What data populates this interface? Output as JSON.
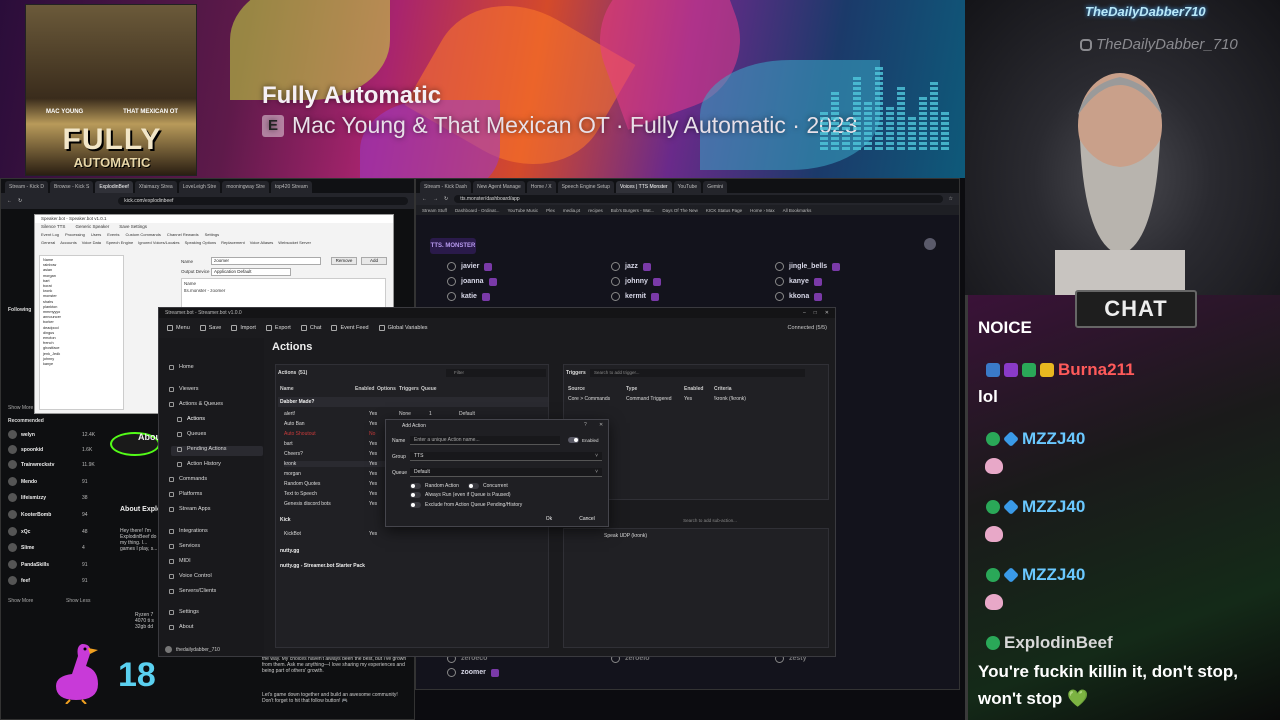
{
  "banner": {
    "album_title": "FULLY",
    "album_subtitle": "AUTOMATIC",
    "album_names": [
      "MAC YOUNG",
      "THAT MEXICAN OT"
    ],
    "song_title": "Fully Automatic",
    "explicit_badge": "E",
    "song_artist": "Mac Young & That Mexican OT · Fully Automatic · 2023"
  },
  "webcam": {
    "tag": "TheDailyDabber710",
    "handle": "TheDailyDabber_710"
  },
  "chat": {
    "header": "CHAT",
    "messages": [
      {
        "text": "NOICE"
      },
      {
        "user": "Burna211",
        "color": "#ff5a5a",
        "text": "lol"
      },
      {
        "user": "MZZJ40",
        "color": "#6ac8ff"
      },
      {
        "user": "MZZJ40",
        "color": "#6ac8ff"
      },
      {
        "user": "MZZJ40",
        "color": "#6ac8ff"
      },
      {
        "user": "ExplodinBeef",
        "color": "#d8d8d8",
        "text_line1": "You're fuckin killin it, don't stop,",
        "text_line2": "won't stop 💚"
      }
    ]
  },
  "left_browser": {
    "tabs": [
      "Stream - Kick D",
      "Browse - Kick S",
      "ExplodinBeef",
      "Xfaimazy Strea",
      "LoveLeigh Stre",
      "mooningway Stre",
      "top420 Stream"
    ],
    "url": "kick.com/explodinbeef",
    "sidebar": {
      "following": "Following",
      "show_more": "Show More",
      "recommended": "Recommended",
      "show_more2": "Show More",
      "show_less": "Show Less",
      "rows": [
        {
          "name": "welyn",
          "count": "12.4K"
        },
        {
          "name": "spoonkid",
          "count": "1.6K"
        },
        {
          "name": "Trainwreckstv",
          "count": "11.9K"
        },
        {
          "name": "Mendo",
          "count": "91"
        },
        {
          "name": "lifeismizzy",
          "count": "38"
        },
        {
          "name": "KooterBomb",
          "count": "94"
        },
        {
          "name": "xQc",
          "count": "48"
        },
        {
          "name": "Slime",
          "count": "4"
        },
        {
          "name": "PandaSkills",
          "count": "91"
        },
        {
          "name": "feef",
          "count": "91"
        }
      ]
    },
    "about_title": "About Explo",
    "about_text": "Hey there! I'm ExplodinBeef do my thing. I... games I play, s...",
    "bio_text": "the way. My choices haven't always been the best, but I've grown from them. Ask me anything—I love sharing my experiences and being part of others' growth.",
    "bio_text2": "Let's game down together and build an awesome community! Don't forget to hit that follow button! 🎮",
    "pc_specs": "Ryzen 7 4070 ti s 32gb dd",
    "follower_count": "18"
  },
  "tts_browser": {
    "tabs": [
      "Stream - Kick Dash",
      "New Agent Manage",
      "Home / X",
      "Speech Engine Setup",
      "Voices | TTS Monster",
      "YouTube",
      "Gemini"
    ],
    "url": "tts.monster/dashboard/app",
    "bookmarks": [
      "Stream Stuff",
      "Dashboard - Ordinat...",
      "YouTube Music",
      "Plex",
      "media.pt",
      "recipes",
      "Bob's Burgers - Wat...",
      "Days Of The New",
      "KICK Status Page",
      "Home › Max",
      "All Bookmarks"
    ],
    "logo": "TTS. MONSTER",
    "voices": [
      {
        "name": "javier"
      },
      {
        "name": "jazz"
      },
      {
        "name": "jingle_bells"
      },
      {
        "name": "joanna"
      },
      {
        "name": "johnny"
      },
      {
        "name": "kanye"
      },
      {
        "name": "katie"
      },
      {
        "name": "kermit"
      },
      {
        "name": "kkona"
      }
    ],
    "bottom_voices": [
      "zeroeco",
      "zeroelo",
      "zesty",
      "zoomer"
    ]
  },
  "speaker": {
    "title": "Speaker.bot - Speaker.bot v1.0.1",
    "menu": [
      "Silence TTS",
      "Generic Speaker",
      "Save Settings"
    ],
    "tabs": [
      "Event Log",
      "Processing",
      "Users",
      "Events",
      "Custom Commands",
      "Channel Rewards",
      "Settings"
    ],
    "subtabs": [
      "General",
      "Accounts",
      "Voice Data",
      "Speech Engine",
      "Ignored Voices/Locales",
      "Speaking Options",
      "Replacement",
      "Voice Aliases",
      "Websocket Server"
    ],
    "voices": [
      "Name",
      "rainbow",
      "asian",
      "morgan",
      "bart",
      "borat",
      "kronk",
      "monster",
      "shahs",
      "plankton",
      "mmmyyyo",
      "announcer",
      "borker",
      "deadpool",
      "dingus",
      "emoton",
      "french",
      "ghostface",
      "jenk_Jedk",
      "johnny",
      "kanye"
    ],
    "alias_name": "zoomer",
    "output_device": "Application Default",
    "name_label": "Name",
    "output_label": "Output Device",
    "remove": "Remove",
    "add": "Add",
    "alias_entry": "tts.monster - zoomer"
  },
  "streamerbot": {
    "title": "Streamer.bot - Streamer.bot v1.0.0",
    "toolbar": [
      "Menu",
      "Save",
      "Import",
      "Export",
      "Chat",
      "Event Feed",
      "Global Variables"
    ],
    "connected": "Connected (5/5)",
    "nav": [
      {
        "label": "Home"
      },
      {
        "label": "Viewers"
      },
      {
        "label": "Actions & Queues"
      },
      {
        "label": "Actions",
        "sub": true,
        "active": true
      },
      {
        "label": "Queues",
        "sub": true
      },
      {
        "label": "Pending Actions",
        "sub": true
      },
      {
        "label": "Action History",
        "sub": true
      },
      {
        "label": "Commands"
      },
      {
        "label": "Platforms"
      },
      {
        "label": "Stream Apps"
      },
      {
        "label": "Integrations"
      },
      {
        "label": "Services"
      },
      {
        "label": "MIDI"
      },
      {
        "label": "Voice Control"
      },
      {
        "label": "Servers/Clients"
      },
      {
        "label": "Settings"
      },
      {
        "label": "About"
      }
    ],
    "user": "thedailydabber_710",
    "page_title": "Actions",
    "actions_label": "Actions",
    "actions_count": "(51)",
    "filter_placeholder": "Filter",
    "columns": [
      "Name",
      "Enabled",
      "Options",
      "Triggers",
      "Queue"
    ],
    "group_dabber": "Dabber Made?",
    "rows": [
      {
        "name": "alert!",
        "enabled": "Yes",
        "options": "None",
        "triggers": "1",
        "queue": "Default"
      },
      {
        "name": "Auto Ban",
        "enabled": "Yes"
      },
      {
        "name": "Auto Shoutout",
        "enabled": "No"
      },
      {
        "name": "bart",
        "enabled": "Yes"
      },
      {
        "name": "Cheers?",
        "enabled": "Yes"
      },
      {
        "name": "kronk",
        "enabled": "Yes"
      },
      {
        "name": "morgan",
        "enabled": "Yes"
      },
      {
        "name": "Random Quotes",
        "enabled": "Yes"
      },
      {
        "name": "Text to Speech",
        "enabled": "Yes"
      },
      {
        "name": "Genesis discord bots",
        "enabled": "Yes"
      }
    ],
    "group_kick": "Kick",
    "kickbot": {
      "name": "KickBot",
      "enabled": "Yes"
    },
    "group_nutty": "nutty.gg",
    "group_starter": "nutty.gg - Streamer.bot Starter Pack",
    "triggers_label": "Triggers",
    "triggers_placeholder": "Search to add trigger...",
    "trigger_columns": [
      "Source",
      "Type",
      "Enabled",
      "Criteria"
    ],
    "trigger_row": {
      "source": "Core > Commands",
      "type": "Command Triggered",
      "enabled": "Yes",
      "criteria": "!kronk (!kronk)"
    },
    "subactions_placeholder": "Search to add sub-action...",
    "subaction": "Speak UDP (kronk)"
  },
  "dialog": {
    "title": "Add Action",
    "name_label": "Name",
    "name_placeholder": "Enter a unique Action name...",
    "enabled_label": "Enabled",
    "group_label": "Group",
    "group_value": "TTS",
    "queue_label": "Queue",
    "queue_value": "Default",
    "opt_random": "Random Action",
    "opt_concurrent": "Concurrent",
    "opt_always": "Always Run (even if Queue is Paused)",
    "opt_exclude": "Exclude from Action Queue Pending/History",
    "ok": "Ok",
    "cancel": "Cancel"
  },
  "colors": {
    "kick_green": "#53fc18",
    "tts_purple": "#7a3aa8",
    "count_blue": "#5ad0f0"
  }
}
